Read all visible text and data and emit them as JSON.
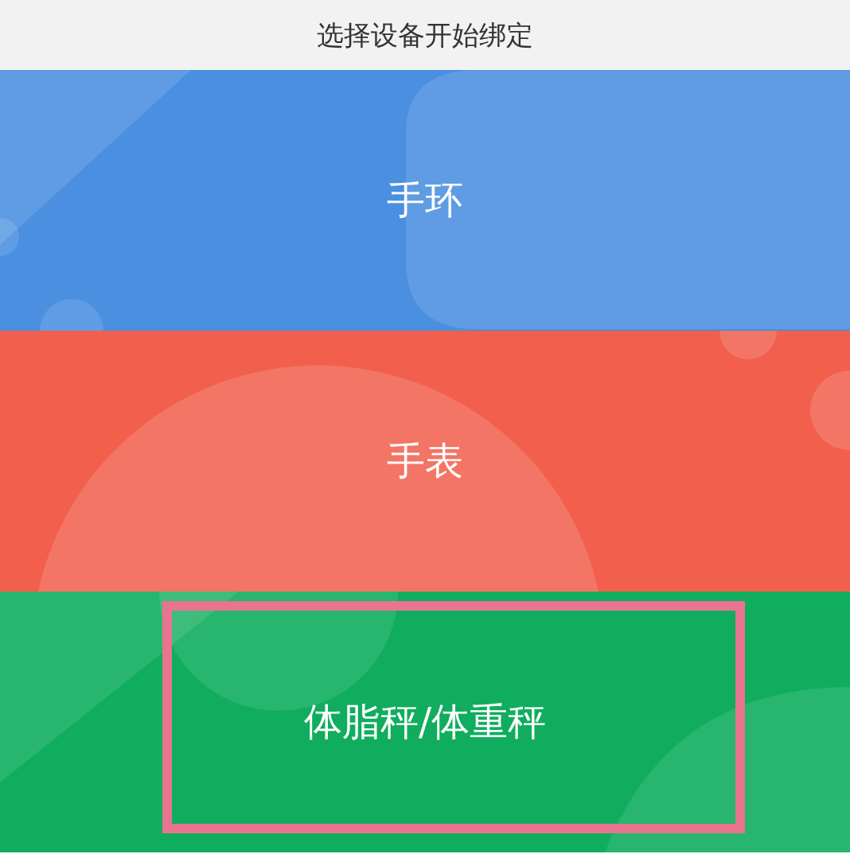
{
  "header": {
    "title": "选择设备开始绑定"
  },
  "devices": [
    {
      "label": "手环",
      "color": "#4a8fe0",
      "highlighted": false
    },
    {
      "label": "手表",
      "color": "#f25f4c",
      "highlighted": false
    },
    {
      "label": "体脂秤/体重秤",
      "color": "#10ad5e",
      "highlighted": true
    }
  ]
}
